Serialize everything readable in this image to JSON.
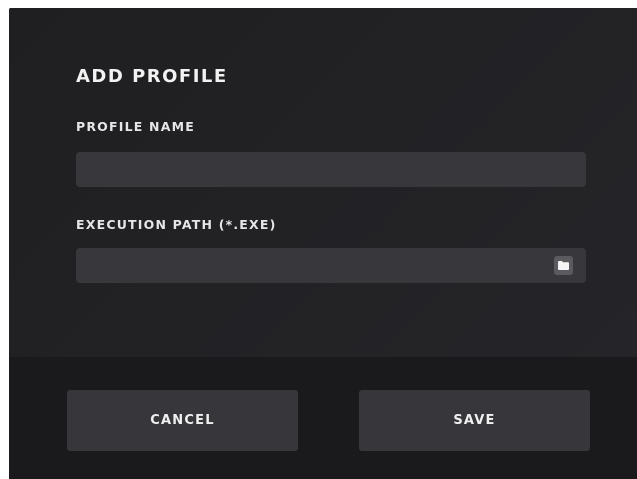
{
  "dialog": {
    "title": "ADD PROFILE",
    "profile_name": {
      "label": "PROFILE NAME",
      "value": "",
      "placeholder": ""
    },
    "execution_path": {
      "label": "EXECUTION PATH (*.EXE)",
      "value": "",
      "placeholder": "",
      "browse_icon": "folder-icon"
    }
  },
  "footer": {
    "cancel_label": "CANCEL",
    "save_label": "SAVE"
  },
  "colors": {
    "dialog_background": "#232326",
    "footer_background": "#1a1a1c",
    "input_background": "#38383c",
    "button_background": "#37373b",
    "text": "#f2f2f2"
  }
}
